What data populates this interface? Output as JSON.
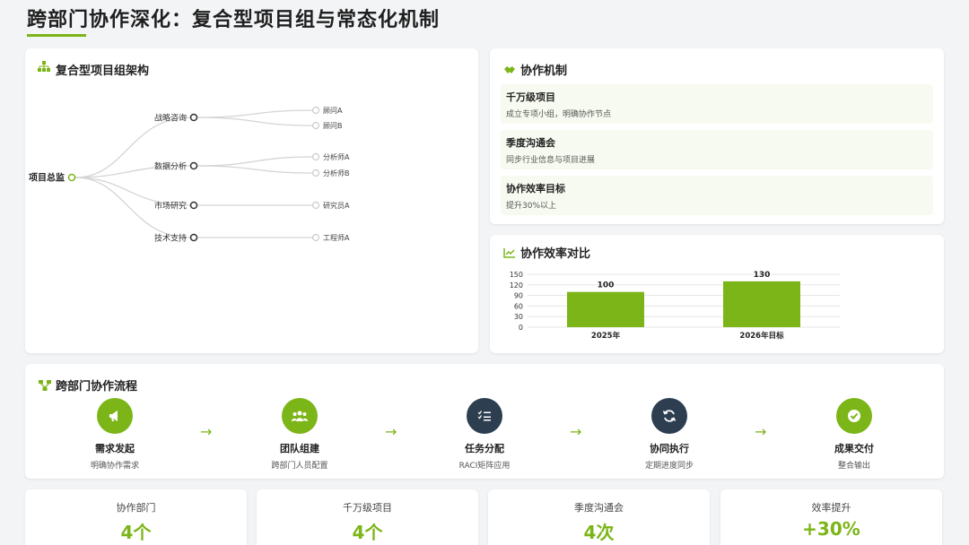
{
  "page": {
    "title": "跨部门协作深化：复合型项目组与常态化机制"
  },
  "org": {
    "heading": "复合型项目组架构",
    "root": "项目总监",
    "branches": [
      {
        "label": "战略咨询",
        "children": [
          "顾问A",
          "顾问B"
        ]
      },
      {
        "label": "数据分析",
        "children": [
          "分析师A",
          "分析师B"
        ]
      },
      {
        "label": "市场研究",
        "children": [
          "研究员A"
        ]
      },
      {
        "label": "技术支持",
        "children": [
          "工程师A"
        ]
      }
    ]
  },
  "mechanism": {
    "heading": "协作机制",
    "items": [
      {
        "title": "千万级项目",
        "desc": "成立专项小组，明确协作节点"
      },
      {
        "title": "季度沟通会",
        "desc": "同步行业信息与项目进展"
      },
      {
        "title": "协作效率目标",
        "desc": "提升30%以上"
      }
    ]
  },
  "chart_data": {
    "type": "bar",
    "title": "协作效率对比",
    "categories": [
      "2025年",
      "2026年目标"
    ],
    "values": [
      100,
      130
    ],
    "ylim": [
      0,
      150
    ],
    "yticks": [
      0,
      30,
      60,
      90,
      120,
      150
    ],
    "grid": true,
    "color": "#7cb518"
  },
  "flow": {
    "heading": "跨部门协作流程",
    "steps": [
      {
        "label": "需求发起",
        "desc": "明确协作需求",
        "icon": "megaphone-icon",
        "color": "#7cb518"
      },
      {
        "label": "团队组建",
        "desc": "跨部门人员配置",
        "icon": "team-icon",
        "color": "#7cb518"
      },
      {
        "label": "任务分配",
        "desc": "RACI矩阵应用",
        "icon": "task-list-icon",
        "color": "#2c3e50"
      },
      {
        "label": "协同执行",
        "desc": "定期进度同步",
        "icon": "sync-icon",
        "color": "#2c3e50"
      },
      {
        "label": "成果交付",
        "desc": "整合输出",
        "icon": "check-badge-icon",
        "color": "#7cb518"
      }
    ],
    "arrow": "→"
  },
  "stats": [
    {
      "label": "协作部门",
      "value": "4个"
    },
    {
      "label": "千万级项目",
      "value": "4个"
    },
    {
      "label": "季度沟通会",
      "value": "4次"
    },
    {
      "label": "效率提升",
      "value": "+30%"
    }
  ],
  "colors": {
    "accent": "#7cb518",
    "dark": "#2c3e50"
  }
}
